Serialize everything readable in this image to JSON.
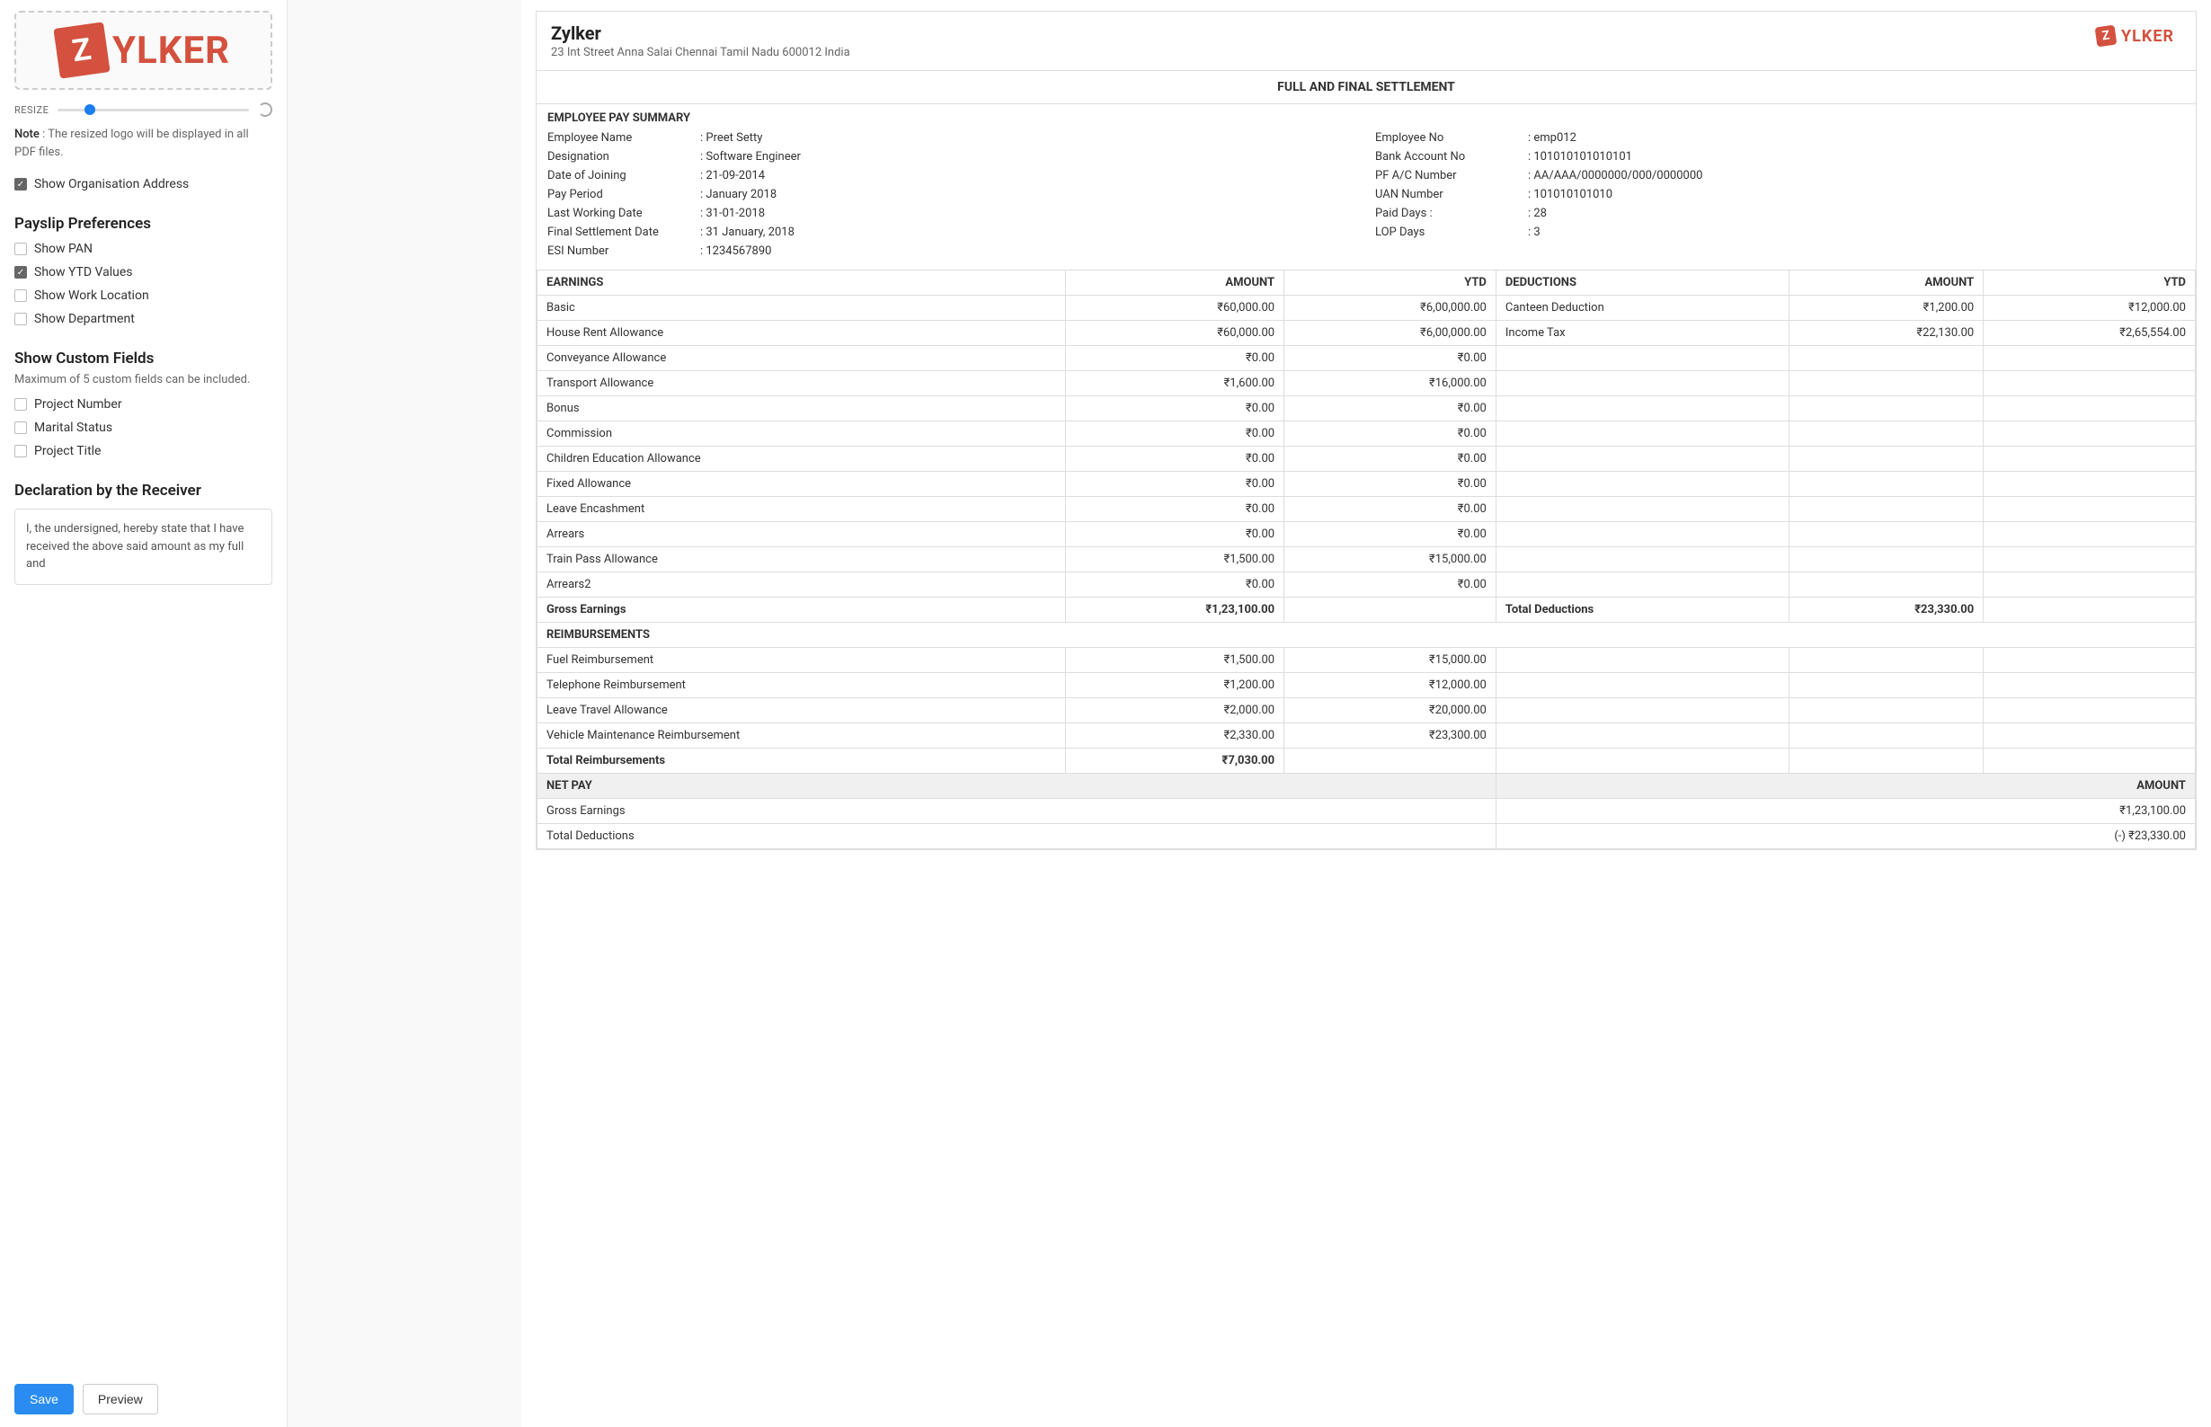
{
  "sidebar": {
    "logo_letter": "Z",
    "logo_text": "YLKER",
    "resize_label": "RESIZE",
    "note_prefix": "Note",
    "note_text": "The resized logo will be displayed in all PDF files.",
    "org_addr_label": "Show Organisation Address",
    "prefs_title": "Payslip Preferences",
    "prefs": [
      {
        "label": "Show PAN",
        "checked": false
      },
      {
        "label": "Show YTD Values",
        "checked": true
      },
      {
        "label": "Show Work Location",
        "checked": false
      },
      {
        "label": "Show Department",
        "checked": false
      }
    ],
    "custom_title": "Show Custom Fields",
    "custom_sub": "Maximum of 5 custom fields can be included.",
    "custom_fields": [
      {
        "label": "Project Number",
        "checked": false
      },
      {
        "label": "Marital Status",
        "checked": false
      },
      {
        "label": "Project Title",
        "checked": false
      }
    ],
    "decl_title": "Declaration by the Receiver",
    "decl_text": "I, the undersigned, hereby state that I have received the above said amount as my full and",
    "save": "Save",
    "preview": "Preview"
  },
  "doc": {
    "company": "Zylker",
    "address": "23 Int Street Anna Salai Chennai Tamil Nadu 600012 India",
    "title": "FULL AND FINAL SETTLEMENT",
    "summary_title": "EMPLOYEE PAY SUMMARY",
    "left": [
      {
        "k": "Employee Name",
        "v": "Preet Setty"
      },
      {
        "k": "Designation",
        "v": "Software Engineer"
      },
      {
        "k": "Date of Joining",
        "v": "21-09-2014"
      },
      {
        "k": "Pay Period",
        "v": "January 2018"
      },
      {
        "k": "Last Working Date",
        "v": "31-01-2018"
      },
      {
        "k": "Final Settlement Date",
        "v": "31 January, 2018"
      },
      {
        "k": "ESI Number",
        "v": "1234567890"
      }
    ],
    "right": [
      {
        "k": "Employee No",
        "v": "emp012"
      },
      {
        "k": "Bank Account No",
        "v": "101010101010101"
      },
      {
        "k": "PF A/C Number",
        "v": "AA/AAA/0000000/000/0000000"
      },
      {
        "k": "UAN Number",
        "v": "101010101010"
      },
      {
        "k": "Paid Days :",
        "v": "28"
      },
      {
        "k": "LOP Days",
        "v": "3"
      }
    ],
    "earn_headers": {
      "earn": "EARNINGS",
      "amt": "AMOUNT",
      "ytd": "YTD",
      "ded": "DEDUCTIONS"
    },
    "earnings": [
      {
        "n": "Basic",
        "a": "₹60,000.00",
        "y": "₹6,00,000.00",
        "dn": "Canteen Deduction",
        "da": "₹1,200.00",
        "dy": "₹12,000.00"
      },
      {
        "n": "House Rent Allowance",
        "a": "₹60,000.00",
        "y": "₹6,00,000.00",
        "dn": "Income Tax",
        "da": "₹22,130.00",
        "dy": "₹2,65,554.00"
      },
      {
        "n": "Conveyance Allowance",
        "a": "₹0.00",
        "y": "₹0.00",
        "dn": "",
        "da": "",
        "dy": ""
      },
      {
        "n": "Transport Allowance",
        "a": "₹1,600.00",
        "y": "₹16,000.00",
        "dn": "",
        "da": "",
        "dy": ""
      },
      {
        "n": "Bonus",
        "a": "₹0.00",
        "y": "₹0.00",
        "dn": "",
        "da": "",
        "dy": ""
      },
      {
        "n": "Commission",
        "a": "₹0.00",
        "y": "₹0.00",
        "dn": "",
        "da": "",
        "dy": ""
      },
      {
        "n": "Children Education Allowance",
        "a": "₹0.00",
        "y": "₹0.00",
        "dn": "",
        "da": "",
        "dy": ""
      },
      {
        "n": "Fixed Allowance",
        "a": "₹0.00",
        "y": "₹0.00",
        "dn": "",
        "da": "",
        "dy": ""
      },
      {
        "n": "Leave Encashment",
        "a": "₹0.00",
        "y": "₹0.00",
        "dn": "",
        "da": "",
        "dy": ""
      },
      {
        "n": "Arrears",
        "a": "₹0.00",
        "y": "₹0.00",
        "dn": "",
        "da": "",
        "dy": ""
      },
      {
        "n": "Train Pass Allowance",
        "a": "₹1,500.00",
        "y": "₹15,000.00",
        "dn": "",
        "da": "",
        "dy": ""
      },
      {
        "n": "Arrears2",
        "a": "₹0.00",
        "y": "₹0.00",
        "dn": "",
        "da": "",
        "dy": ""
      }
    ],
    "gross": {
      "label": "Gross Earnings",
      "amt": "₹1,23,100.00",
      "dlabel": "Total Deductions",
      "damt": "₹23,330.00"
    },
    "reimb_title": "REIMBURSEMENTS",
    "reimb": [
      {
        "n": "Fuel Reimbursement",
        "a": "₹1,500.00",
        "y": "₹15,000.00"
      },
      {
        "n": "Telephone Reimbursement",
        "a": "₹1,200.00",
        "y": "₹12,000.00"
      },
      {
        "n": "Leave Travel Allowance",
        "a": "₹2,000.00",
        "y": "₹20,000.00"
      },
      {
        "n": "Vehicle Maintenance Reimbursement",
        "a": "₹2,330.00",
        "y": "₹23,300.00"
      }
    ],
    "reimb_total": {
      "label": "Total Reimbursements",
      "amt": "₹7,030.00"
    },
    "netpay": {
      "label": "NET PAY",
      "amt_label": "AMOUNT"
    },
    "net_rows": [
      {
        "n": "Gross Earnings",
        "a": "₹1,23,100.00"
      },
      {
        "n": "Total Deductions",
        "a": "(-) ₹23,330.00"
      }
    ]
  }
}
